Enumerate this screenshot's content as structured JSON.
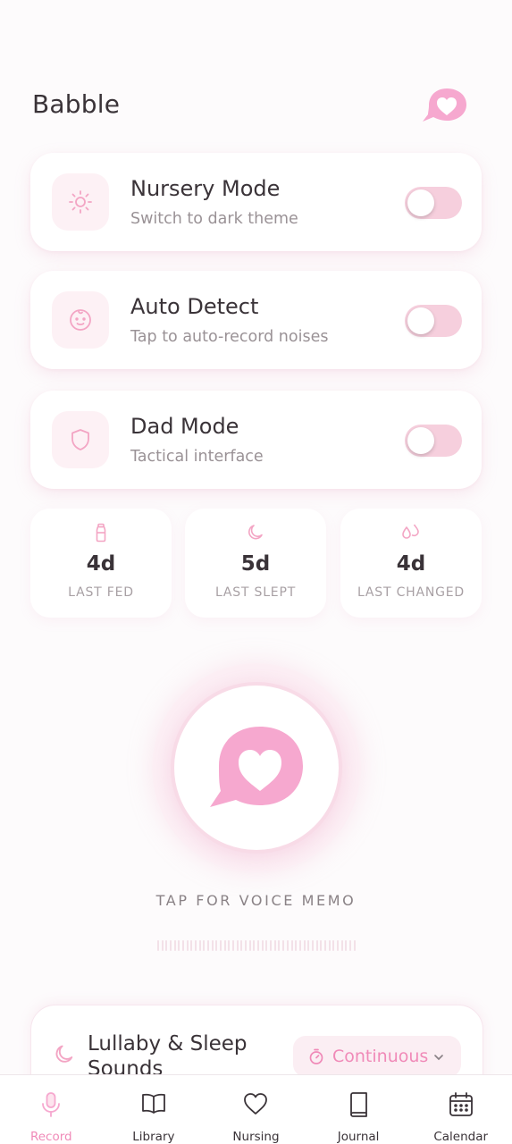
{
  "app": {
    "title": "Babble"
  },
  "colors": {
    "accent": "#f08ab8",
    "accent_light": "#f6cfdd",
    "text": "#3a3338",
    "muted": "#9a9296"
  },
  "settings": [
    {
      "icon": "sun-icon",
      "title": "Nursery Mode",
      "subtitle": "Switch to dark theme",
      "enabled": false
    },
    {
      "icon": "baby-face-icon",
      "title": "Auto Detect",
      "subtitle": "Tap to auto-record noises",
      "enabled": false
    },
    {
      "icon": "shield-icon",
      "title": "Dad Mode",
      "subtitle": "Tactical interface",
      "enabled": false
    }
  ],
  "stats": [
    {
      "icon": "bottle-icon",
      "value": "4d",
      "label": "LAST FED"
    },
    {
      "icon": "moon-icon",
      "value": "5d",
      "label": "LAST SLEPT"
    },
    {
      "icon": "droplets-icon",
      "value": "4d",
      "label": "LAST CHANGED"
    }
  ],
  "voice_memo": {
    "label": "TAP FOR VOICE MEMO"
  },
  "lullaby": {
    "title": "Lullaby & Sleep Sounds",
    "mode": "Continuous"
  },
  "nav": [
    {
      "icon": "mic-icon",
      "label": "Record",
      "active": true
    },
    {
      "icon": "book-open-icon",
      "label": "Library",
      "active": false
    },
    {
      "icon": "heart-icon",
      "label": "Nursing",
      "active": false
    },
    {
      "icon": "journal-icon",
      "label": "Journal",
      "active": false
    },
    {
      "icon": "calendar-icon",
      "label": "Calendar",
      "active": false
    }
  ]
}
